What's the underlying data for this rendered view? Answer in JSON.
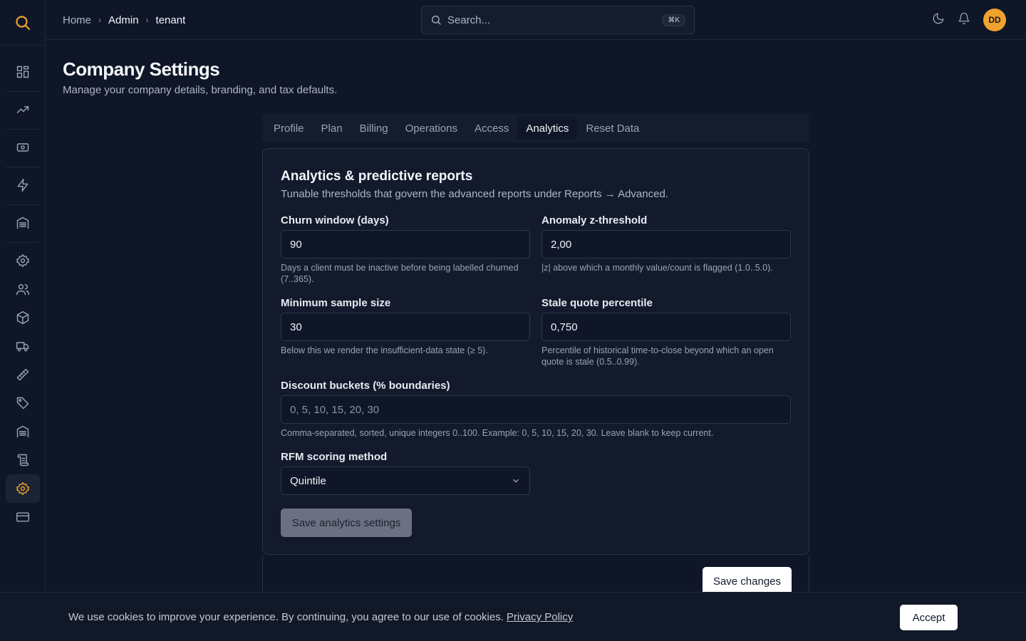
{
  "header": {
    "breadcrumb": [
      "Home",
      "Admin",
      "tenant"
    ],
    "search_placeholder": "Search...",
    "search_shortcut": "⌘K",
    "avatar_initials": "DD"
  },
  "page": {
    "title": "Company Settings",
    "subtitle": "Manage your company details, branding, and tax defaults."
  },
  "tabs": [
    {
      "label": "Profile"
    },
    {
      "label": "Plan"
    },
    {
      "label": "Billing"
    },
    {
      "label": "Operations"
    },
    {
      "label": "Access"
    },
    {
      "label": "Analytics",
      "active": true
    },
    {
      "label": "Reset Data"
    }
  ],
  "card": {
    "title": "Analytics & predictive reports",
    "subtitle": "Tunable thresholds that govern the advanced reports under Reports → Advanced.",
    "churn": {
      "label": "Churn window (days)",
      "value": "90",
      "help": "Days a client must be inactive before being labelled churned (7..365)."
    },
    "anomaly": {
      "label": "Anomaly z-threshold",
      "value": "2,00",
      "help": "|z| above which a monthly value/count is flagged (1.0..5.0)."
    },
    "sample": {
      "label": "Minimum sample size",
      "value": "30",
      "help": "Below this we render the insufficient-data state (≥ 5)."
    },
    "stale": {
      "label": "Stale quote percentile",
      "value": "0,750",
      "help": "Percentile of historical time-to-close beyond which an open quote is stale (0.5..0.99)."
    },
    "buckets": {
      "label": "Discount buckets (% boundaries)",
      "placeholder": "0, 5, 10, 15, 20, 30",
      "help": "Comma-separated, sorted, unique integers 0..100. Example: 0, 5, 10, 15, 20, 30. Leave blank to keep current."
    },
    "rfm": {
      "label": "RFM scoring method",
      "value": "Quintile"
    },
    "save_label": "Save analytics settings"
  },
  "save_changes_label": "Save changes",
  "cookie": {
    "text": "We use cookies to improve your experience. By continuing, you agree to our use of cookies.",
    "link": "Privacy Policy",
    "accept": "Accept"
  },
  "colors": {
    "accent": "#f0a22e",
    "background": "#0f1627"
  }
}
